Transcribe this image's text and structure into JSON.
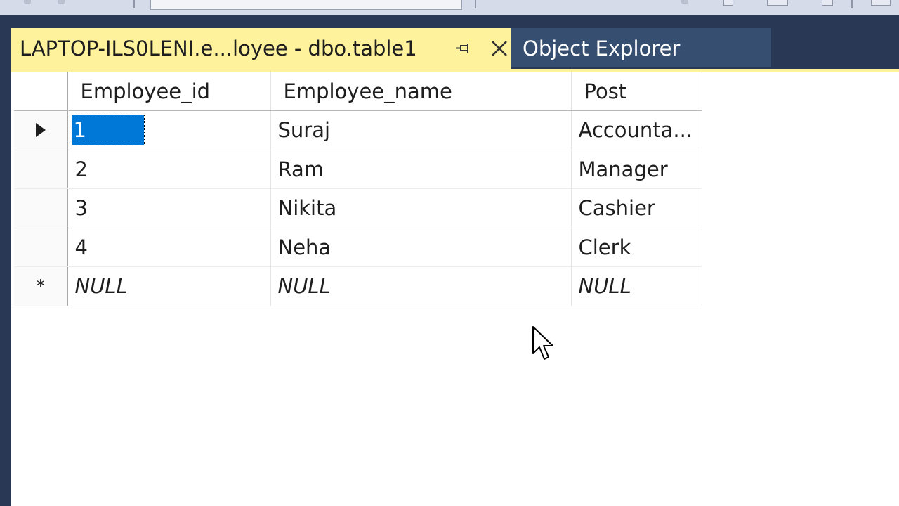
{
  "tabs": {
    "active_label": "LAPTOP-ILS0LENI.e...loyee - dbo.table1",
    "inactive_label": "Object Explorer",
    "pin_icon": "pin-icon",
    "close_icon": "close-icon"
  },
  "grid": {
    "headers": [
      "Employee_id",
      "Employee_name",
      "Post"
    ],
    "rows": [
      {
        "id": "1",
        "name": "Suraj",
        "post": "Accounta..."
      },
      {
        "id": "2",
        "name": "Ram",
        "post": "Manager"
      },
      {
        "id": "3",
        "name": "Nikita",
        "post": "Cashier"
      },
      {
        "id": "4",
        "name": "Neha",
        "post": "Clerk"
      }
    ],
    "new_row": {
      "marker": "*",
      "id": "NULL",
      "name": "NULL",
      "post": "NULL"
    }
  },
  "colors": {
    "window_bg": "#293955",
    "active_tab": "#fff29d",
    "inactive_tab": "#364e6f",
    "selection": "#0078d7"
  }
}
